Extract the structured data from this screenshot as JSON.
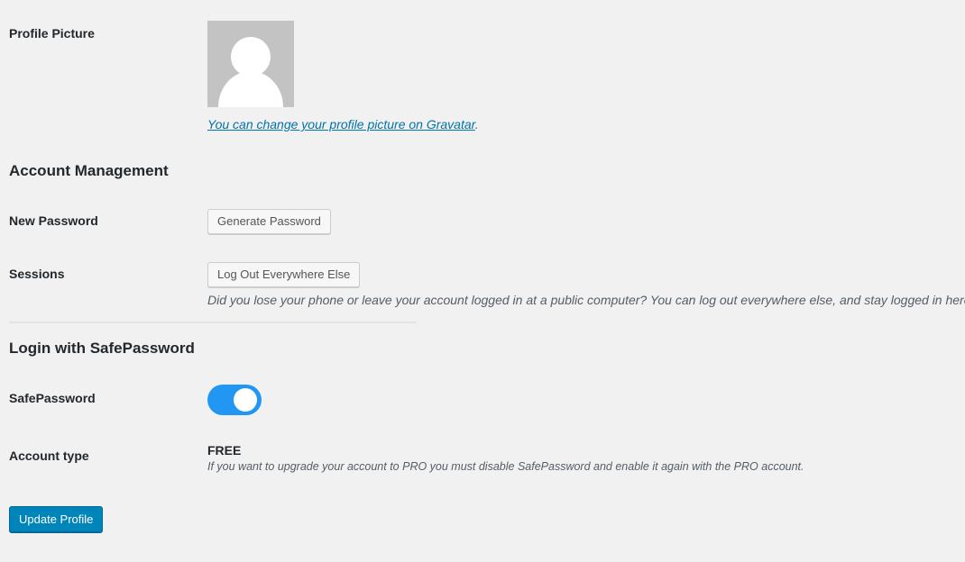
{
  "profile_picture": {
    "label": "Profile Picture",
    "gravatar_link": "You can change your profile picture on Gravatar",
    "gravatar_suffix": "."
  },
  "account_management": {
    "title": "Account Management",
    "new_password_label": "New Password",
    "generate_password_button": "Generate Password",
    "sessions_label": "Sessions",
    "logout_button": "Log Out Everywhere Else",
    "sessions_description": "Did you lose your phone or leave your account logged in at a public computer? You can log out everywhere else, and stay logged in here."
  },
  "safepassword": {
    "title": "Login with SafePassword",
    "toggle_label": "SafePassword",
    "toggle_on": true,
    "account_type_label": "Account type",
    "account_type_value": "FREE",
    "account_type_description": "If you want to upgrade your account to PRO you must disable SafePassword and enable it again with the PRO account."
  },
  "footer": {
    "update_button": "Update Profile"
  },
  "colors": {
    "toggle_on": "#2196f3",
    "primary_button": "#0085ba",
    "link": "#0073aa"
  }
}
